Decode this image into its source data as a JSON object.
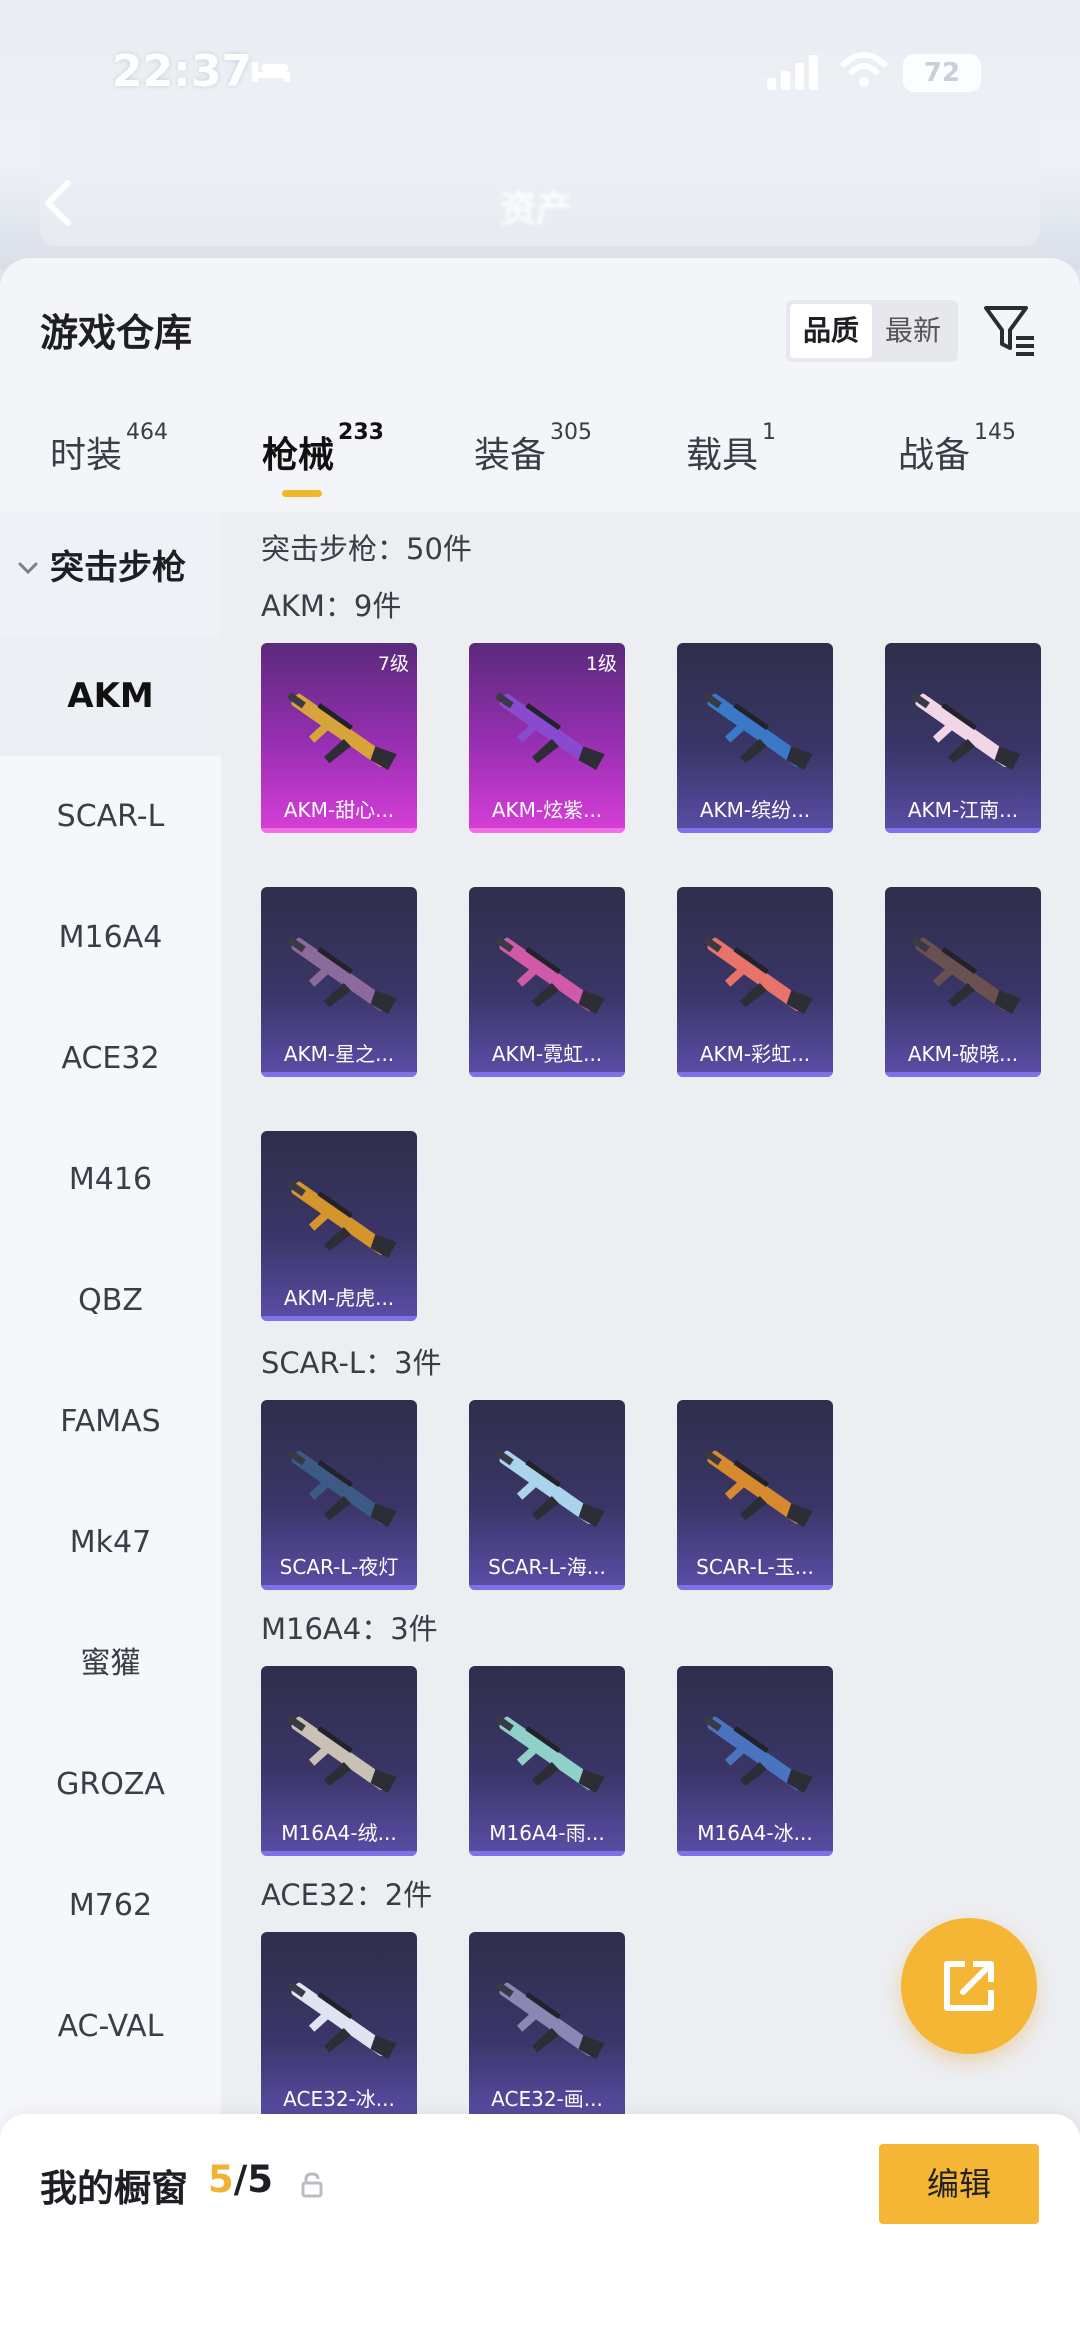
{
  "status_bar": {
    "time": "22:37",
    "battery": "72"
  },
  "header": {
    "title": "资产"
  },
  "sheet": {
    "title": "游戏仓库",
    "sort_options": [
      "品质",
      "最新"
    ],
    "tabs": [
      {
        "label": "时装",
        "count": "464"
      },
      {
        "label": "枪械",
        "count": "233"
      },
      {
        "label": "装备",
        "count": "305"
      },
      {
        "label": "载具",
        "count": "1"
      },
      {
        "label": "战备",
        "count": "145"
      }
    ]
  },
  "sidebar": {
    "category": "突击步枪",
    "items": [
      "AKM",
      "SCAR-L",
      "M16A4",
      "ACE32",
      "M416",
      "QBZ",
      "FAMAS",
      "Mk47",
      "蜜獾",
      "GROZA",
      "M762",
      "AC-VAL"
    ]
  },
  "content": {
    "summary": "突击步枪：50件",
    "groups": [
      {
        "label": "AKM：9件",
        "items": [
          {
            "name": "AKM-甜心...",
            "level": "7级",
            "rarity": "epic",
            "color": "#d6a43a"
          },
          {
            "name": "AKM-炫紫...",
            "level": "1级",
            "rarity": "epic",
            "color": "#8a4ad0"
          },
          {
            "name": "AKM-缤纷...",
            "level": "",
            "rarity": "normal",
            "color": "#3a78c8"
          },
          {
            "name": "AKM-江南...",
            "level": "",
            "rarity": "normal",
            "color": "#f0d6e6"
          },
          {
            "name": "AKM-星之...",
            "level": "",
            "rarity": "normal",
            "color": "#8c6a9c"
          },
          {
            "name": "AKM-霓虹...",
            "level": "",
            "rarity": "normal",
            "color": "#d05aa8"
          },
          {
            "name": "AKM-彩虹...",
            "level": "",
            "rarity": "normal",
            "color": "#e7736a"
          },
          {
            "name": "AKM-破晓...",
            "level": "",
            "rarity": "normal",
            "color": "#6b5050"
          },
          {
            "name": "AKM-虎虎...",
            "level": "",
            "rarity": "normal",
            "color": "#d4962c"
          }
        ]
      },
      {
        "label": "SCAR-L：3件",
        "items": [
          {
            "name": "SCAR-L-夜灯",
            "level": "",
            "rarity": "normal",
            "color": "#3d5a86"
          },
          {
            "name": "SCAR-L-海...",
            "level": "",
            "rarity": "normal",
            "color": "#a9d4ea"
          },
          {
            "name": "SCAR-L-玉...",
            "level": "",
            "rarity": "normal",
            "color": "#d78a2d"
          }
        ]
      },
      {
        "label": "M16A4：3件",
        "items": [
          {
            "name": "M16A4-绒...",
            "level": "",
            "rarity": "normal",
            "color": "#c9c0b6"
          },
          {
            "name": "M16A4-雨...",
            "level": "",
            "rarity": "normal",
            "color": "#8fd0c8"
          },
          {
            "name": "M16A4-冰...",
            "level": "",
            "rarity": "normal",
            "color": "#4a74c0"
          }
        ]
      },
      {
        "label": "ACE32：2件",
        "items": [
          {
            "name": "ACE32-冰...",
            "level": "",
            "rarity": "normal",
            "color": "#dfe4f2"
          },
          {
            "name": "ACE32-画...",
            "level": "",
            "rarity": "normal",
            "color": "#8c86b4"
          }
        ]
      }
    ]
  },
  "bottom_bar": {
    "title": "我的橱窗",
    "current": "5",
    "total": "/5",
    "edit_label": "编辑"
  },
  "icons": {
    "back": "back-arrow-icon",
    "filter": "filter-icon",
    "share": "share-external-icon",
    "lock": "lock-icon"
  },
  "colors": {
    "accent": "#f4b634",
    "epic": "#c33ad0",
    "normal": "#4b3f8e"
  }
}
